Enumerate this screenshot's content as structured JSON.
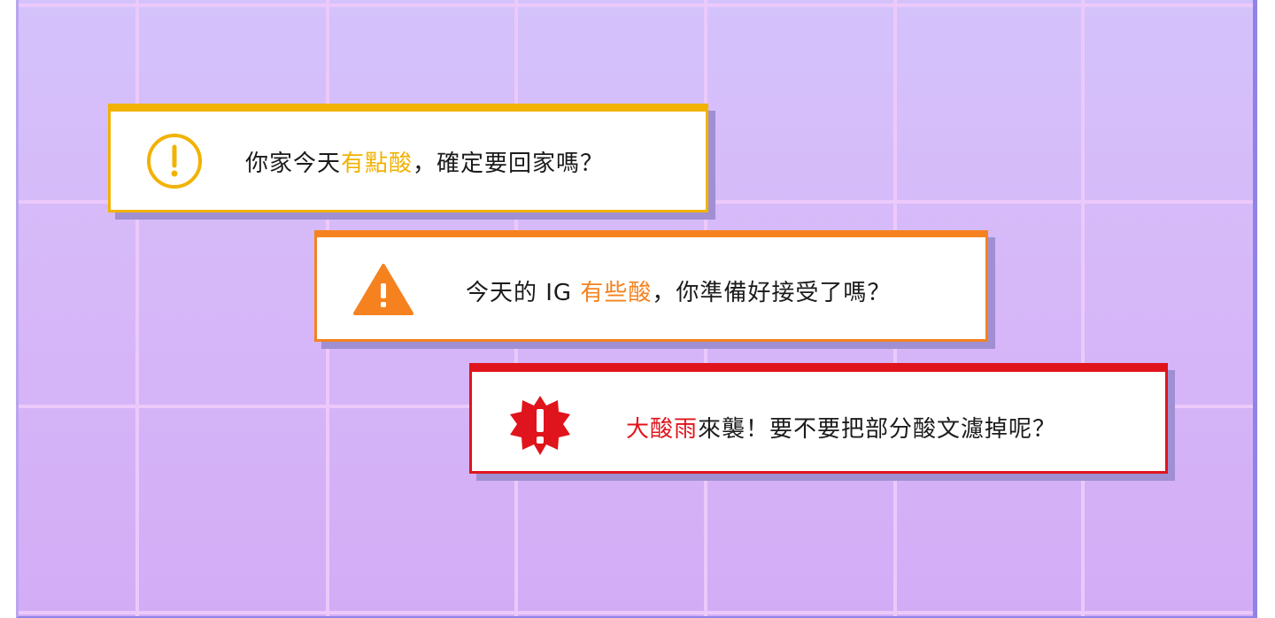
{
  "colors": {
    "background": "#d4c2fb",
    "grid": "#ecc9fb",
    "notice": "#f2b200",
    "warning": "#f5821f",
    "danger": "#e0141c",
    "text": "#1b1b1b"
  },
  "toasts": [
    {
      "level": "notice",
      "icon": "exclamation-circle-icon",
      "text_before": "你家今天",
      "highlight": "有點酸",
      "text_after": "，確定要回家嗎？"
    },
    {
      "level": "warning",
      "icon": "warning-triangle-icon",
      "text_before": "今天的 IG ",
      "highlight": "有些酸",
      "text_after": "，你準備好接受了嗎？"
    },
    {
      "level": "danger",
      "icon": "alert-burst-icon",
      "text_before": "",
      "highlight": "大酸雨",
      "text_after": "來襲！要不要把部分酸文濾掉呢？"
    }
  ]
}
